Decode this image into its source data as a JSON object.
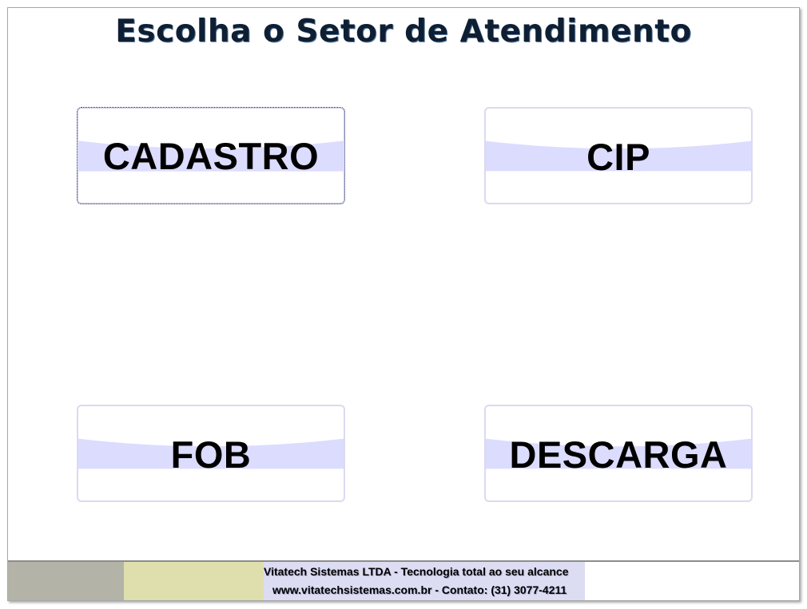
{
  "page": {
    "title": "Escolha o Setor de Atendimento"
  },
  "sectors": [
    {
      "label": "CADASTRO",
      "focused": true
    },
    {
      "label": "CIP",
      "focused": false
    },
    {
      "label": "FOB",
      "focused": false
    },
    {
      "label": "DESCARGA",
      "focused": false
    }
  ],
  "footer": {
    "line1": "Vitatech Sistemas LTDA - Tecnologia total ao seu alcance",
    "line2": "www.vitatechsistemas.com.br - Contato: (31) 3077-4211"
  },
  "colors": {
    "title": "#0f1f33",
    "button_border": "#dadaf0",
    "button_wave": "#dcdcff",
    "footer_gray": "#b3b3a8",
    "footer_yellow": "#dfdfad",
    "footer_text_bg": "#dcdcf3"
  }
}
